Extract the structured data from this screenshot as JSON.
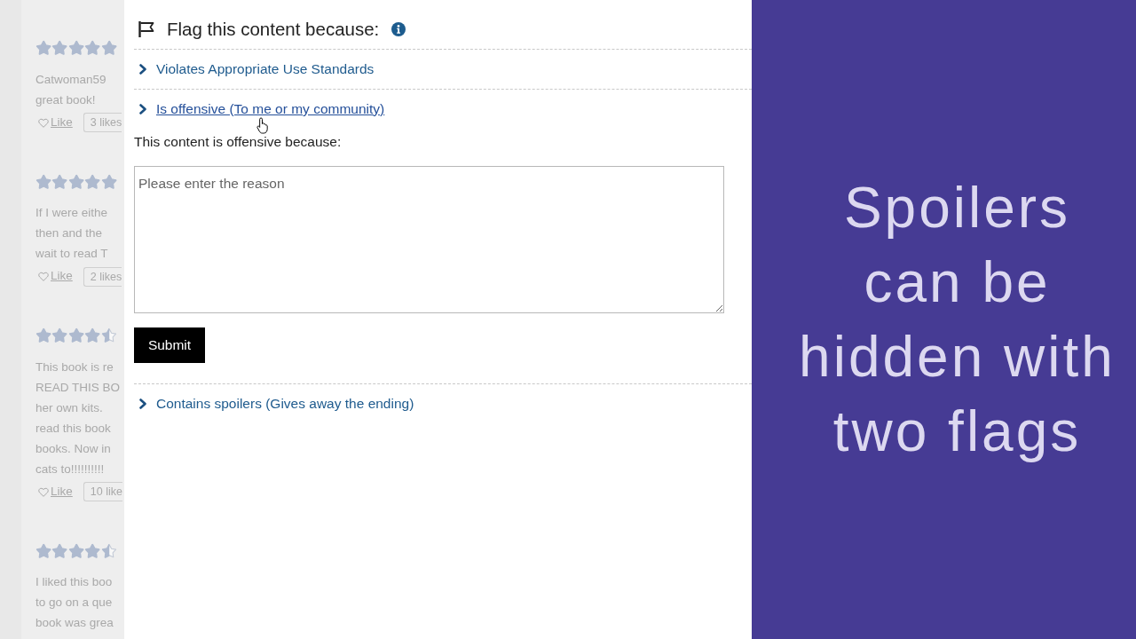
{
  "background_reviews": [
    {
      "stars": 5,
      "lines": [
        "Catwoman59",
        "great book!"
      ],
      "like": "Like",
      "likes": "3 likes"
    },
    {
      "stars": 5,
      "lines": [
        "If I were eithe",
        "then and the",
        "wait to read T"
      ],
      "like": "Like",
      "likes": "2 likes"
    },
    {
      "stars": 4.5,
      "lines": [
        "This book is re",
        "READ THIS BO",
        "her own kits.",
        "read this book",
        "books. Now in",
        "cats to!!!!!!!!!!"
      ],
      "like": "Like",
      "likes": "10 like"
    },
    {
      "stars": 4.5,
      "lines": [
        "I liked this boo",
        "to go on a que",
        "book was grea"
      ]
    }
  ],
  "dialog": {
    "title": "Flag this content because:",
    "reasons": [
      {
        "label": "Violates Appropriate Use Standards",
        "expanded": false
      },
      {
        "label": "Is offensive (To me or my community)",
        "expanded": true,
        "prompt": "This content is offensive because:",
        "reason_field": {
          "placeholder": "Please enter the reason"
        },
        "submit_label": "Submit"
      },
      {
        "label": "Contains spoilers (Gives away the ending)",
        "expanded": false
      }
    ]
  },
  "caption": {
    "text": "Spoilers can be hidden with two flags"
  }
}
